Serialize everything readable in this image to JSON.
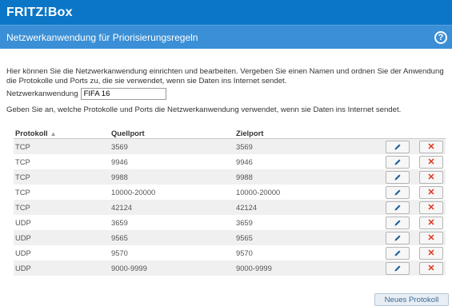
{
  "header": {
    "brand": "FRITZ!Box"
  },
  "titlebar": {
    "title": "Netzwerkanwendung für Priorisierungsregeln",
    "help": "?"
  },
  "intro": "Hier können Sie die Netzwerkanwendung einrichten und bearbeiten. Vergeben Sie einen Namen und ordnen Sie der Anwendung die Protokolle und Ports zu, die sie verwendet, wenn sie Daten ins Internet sendet.",
  "app_field": {
    "label": "Netzwerkanwendung",
    "value": "FIFA 16"
  },
  "hint": "Geben Sie an, welche Protokolle und Ports die Netzwerkanwendung verwendet, wenn sie Daten ins Internet sendet.",
  "table": {
    "headers": {
      "protocol": "Protokoll",
      "source": "Quellport",
      "dest": "Zielport"
    },
    "rows": [
      {
        "protocol": "TCP",
        "source": "3569",
        "dest": "3569"
      },
      {
        "protocol": "TCP",
        "source": "9946",
        "dest": "9946"
      },
      {
        "protocol": "TCP",
        "source": "9988",
        "dest": "9988"
      },
      {
        "protocol": "TCP",
        "source": "10000-20000",
        "dest": "10000-20000"
      },
      {
        "protocol": "TCP",
        "source": "42124",
        "dest": "42124"
      },
      {
        "protocol": "UDP",
        "source": "3659",
        "dest": "3659"
      },
      {
        "protocol": "UDP",
        "source": "9565",
        "dest": "9565"
      },
      {
        "protocol": "UDP",
        "source": "9570",
        "dest": "9570"
      },
      {
        "protocol": "UDP",
        "source": "9000-9999",
        "dest": "9000-9999"
      }
    ]
  },
  "new_protocol_button": "Neues Protokoll",
  "colors": {
    "brand_bar": "#0b76c6",
    "title_bar": "#3a8fd6",
    "delete": "#e2331a",
    "edit": "#1a5e9a"
  },
  "icons": {
    "edit": "pencil-icon",
    "delete": "close-icon",
    "sort": "sort-icon",
    "help": "help-icon"
  }
}
